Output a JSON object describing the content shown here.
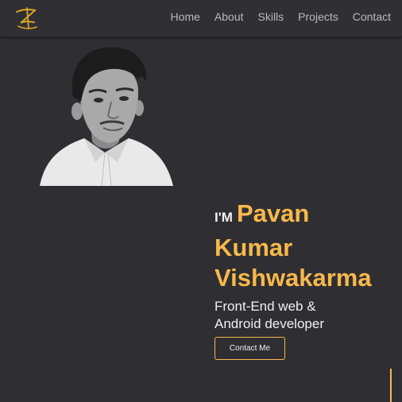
{
  "nav": {
    "items": [
      {
        "label": "Home"
      },
      {
        "label": "About"
      },
      {
        "label": "Skills"
      },
      {
        "label": "Projects"
      },
      {
        "label": "Contact"
      }
    ]
  },
  "hero": {
    "greeting": "I'M",
    "name_line1": "Pavan",
    "name_line2": "Kumar",
    "name_line3": "Vishwakarma",
    "role_line1": "Front-End web &",
    "role_line2": "Android developer",
    "cta_label": "Contact Me"
  },
  "colors": {
    "background": "#2f2f33",
    "accent": "#f7b84b",
    "nav_text": "#b9b9bd",
    "text": "#f0f0f0"
  },
  "icons": {
    "logo": "signature-logo-icon",
    "photo": "profile-portrait"
  }
}
